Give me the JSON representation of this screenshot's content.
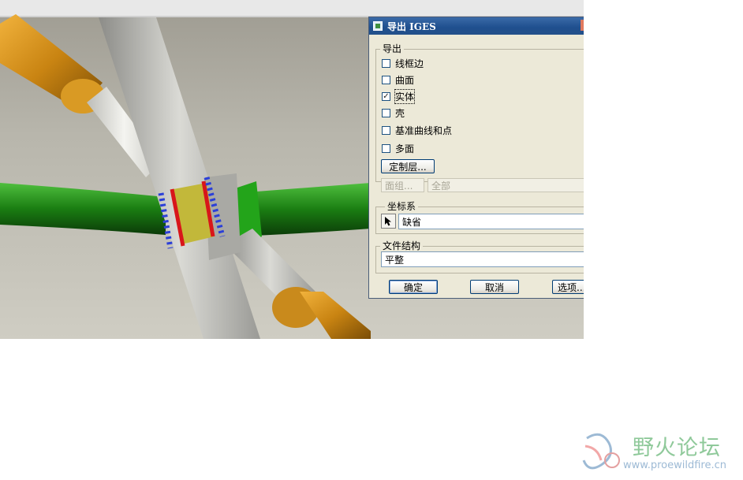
{
  "dialog": {
    "title": "导出 IGES",
    "export_group": {
      "label": "导出",
      "options": [
        {
          "label": "线框边",
          "checked": false
        },
        {
          "label": "曲面",
          "checked": false
        },
        {
          "label": "实体",
          "checked": true
        },
        {
          "label": "壳",
          "checked": false
        },
        {
          "label": "基准曲线和点",
          "checked": false
        },
        {
          "label": "多面",
          "checked": false
        }
      ],
      "custom_layers_button": "定制层...",
      "facet_group_button": "面组...",
      "facet_group_value": "全部"
    },
    "coordinate_system": {
      "label": "坐标系",
      "value": "缺省"
    },
    "file_structure": {
      "label": "文件结构",
      "value": "平整"
    },
    "buttons": {
      "ok": "确定",
      "cancel": "取消",
      "options": "选项..."
    }
  },
  "watermark": {
    "title": "野火论坛",
    "url": "www.proewildfire.cn"
  },
  "colors": {
    "title_bar": "#23508a",
    "dialog_bg": "#ece9d8",
    "tube_orange": "#c98412",
    "tube_green": "#1a7d12",
    "tube_gray": "#b9b9b4",
    "watermark_green": "#8fc99a"
  }
}
